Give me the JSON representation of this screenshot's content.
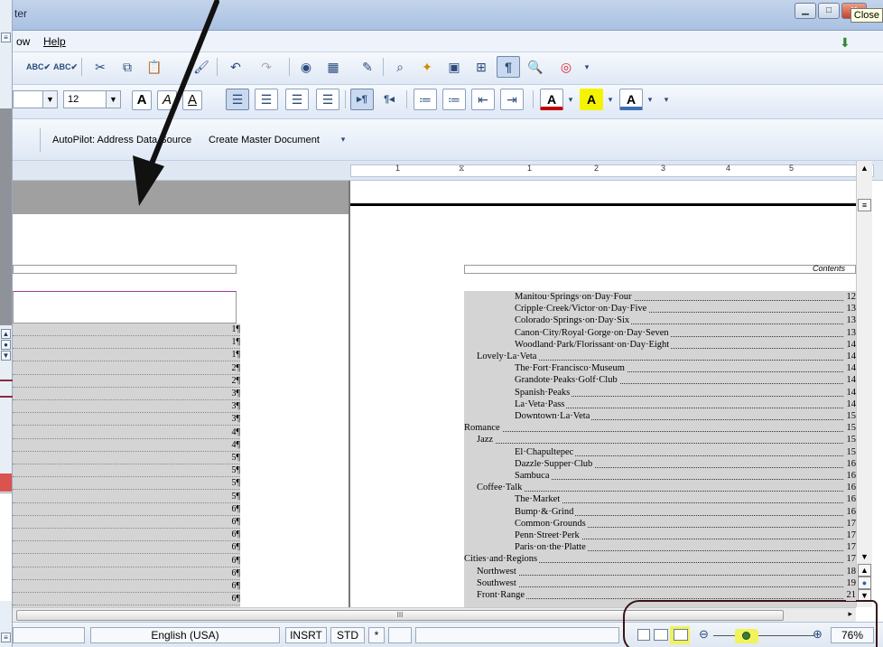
{
  "window": {
    "title_fragment": "ter",
    "tooltip": "Close"
  },
  "menubar": {
    "items": [
      "ow",
      "Help"
    ]
  },
  "toolbar_format": {
    "font_size": "12",
    "autopilot": "AutoPilot: Address Data Source",
    "master_doc": "Create Master Document"
  },
  "ruler": {
    "marks": [
      "1",
      "1",
      "2",
      "3",
      "4",
      "5"
    ]
  },
  "left_pages": [
    "1¶",
    "1¶",
    "1¶",
    "2¶",
    "2¶",
    "3¶",
    "3¶",
    "3¶",
    "4¶",
    "4¶",
    "5¶",
    "5¶",
    "5¶",
    "5¶",
    "6¶",
    "6¶",
    "6¶",
    "6¶",
    "6¶",
    "6¶",
    "6¶",
    "6¶"
  ],
  "header": {
    "contents_label": "Contents"
  },
  "toc": [
    {
      "text": "Manitou·Springs·on·Day·Four",
      "page": "12",
      "level": 3
    },
    {
      "text": "Cripple·Creek/Victor·on·Day·Five",
      "page": "13",
      "level": 3
    },
    {
      "text": "Colorado·Springs·on·Day·Six",
      "page": "13",
      "level": 3
    },
    {
      "text": "Canon·City/Royal·Gorge·on·Day·Seven",
      "page": "13",
      "level": 3
    },
    {
      "text": "Woodland·Park/Florissant·on·Day·Eight",
      "page": "14",
      "level": 3
    },
    {
      "text": "Lovely·La·Veta",
      "page": "14",
      "level": 2
    },
    {
      "text": "The·Fort·Francisco·Museum",
      "page": "14",
      "level": 3
    },
    {
      "text": "Grandote·Peaks·Golf·Club",
      "page": "14",
      "level": 3
    },
    {
      "text": "Spanish·Peaks",
      "page": "14",
      "level": 3
    },
    {
      "text": "La·Veta·Pass",
      "page": "14",
      "level": 3
    },
    {
      "text": "Downtown·La·Veta",
      "page": "15",
      "level": 3
    },
    {
      "text": "Romance",
      "page": "15",
      "level": 1
    },
    {
      "text": "Jazz",
      "page": "15",
      "level": 2
    },
    {
      "text": "El·Chapultepec",
      "page": "15",
      "level": 3
    },
    {
      "text": "Dazzle·Supper·Club",
      "page": "16",
      "level": 3
    },
    {
      "text": "Sambuca",
      "page": "16",
      "level": 3
    },
    {
      "text": "Coffee·Talk",
      "page": "16",
      "level": 2
    },
    {
      "text": "The·Market",
      "page": "16",
      "level": 3
    },
    {
      "text": "Bump·&·Grind",
      "page": "16",
      "level": 3
    },
    {
      "text": "Common·Grounds",
      "page": "17",
      "level": 3
    },
    {
      "text": "Penn·Street·Perk",
      "page": "17",
      "level": 3
    },
    {
      "text": "Paris·on·the·Platte",
      "page": "17",
      "level": 3
    },
    {
      "text": "Cities·and·Regions",
      "page": "17",
      "level": 1
    },
    {
      "text": "Northwest",
      "page": "18",
      "level": 2
    },
    {
      "text": "Southwest",
      "page": "19",
      "level": 2
    },
    {
      "text": "Front·Range",
      "page": "21",
      "level": 2
    }
  ],
  "statusbar": {
    "language": "English (USA)",
    "insert_mode": "INSRT",
    "selection_mode": "STD",
    "modified": "*",
    "zoom": "76%"
  },
  "hscroll": {
    "grip": "III"
  },
  "colors": {
    "annotation": "#3a1418",
    "highlight": "#f2f25a",
    "font_color_bar": "#c00000"
  }
}
